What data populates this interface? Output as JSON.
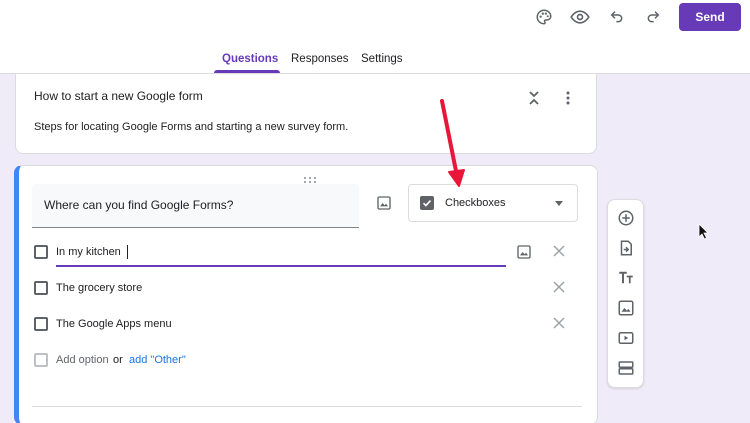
{
  "toolbar": {
    "icons": [
      "palette-icon",
      "preview-eye-icon",
      "undo-icon",
      "redo-icon"
    ],
    "send_label": "Send"
  },
  "tabs": [
    {
      "label": "Questions",
      "active": true
    },
    {
      "label": "Responses",
      "active": false
    },
    {
      "label": "Settings",
      "active": false
    }
  ],
  "form": {
    "title": "How to start a new Google form",
    "description": "Steps for locating Google Forms and starting a new survey form."
  },
  "question": {
    "text": "Where can you find Google Forms?",
    "type_label": "Checkboxes",
    "options": [
      {
        "label": "In my kitchen",
        "editing": true
      },
      {
        "label": "The grocery store"
      },
      {
        "label": "The Google Apps menu"
      }
    ],
    "add_option_label": "Add option",
    "or_label": "or",
    "add_other_label": "add \"Other\""
  },
  "side_toolbar": [
    "add-question-icon",
    "import-questions-icon",
    "add-title-icon",
    "add-image-icon",
    "add-video-icon",
    "add-section-icon"
  ],
  "colors": {
    "accent": "#673ab7",
    "background": "#f0ebf8",
    "card_focus": "#4285f4",
    "link": "#1a73e8",
    "annotation_arrow": "#e8173a"
  }
}
